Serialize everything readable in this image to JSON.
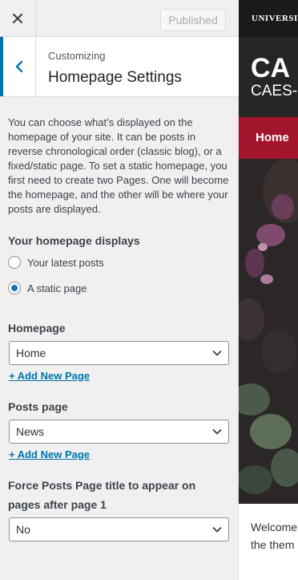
{
  "topbar": {
    "close_icon": "close-icon",
    "publish_label": "Published"
  },
  "section": {
    "back_icon": "chevron-left-icon",
    "breadcrumb": "Customizing",
    "title": "Homepage Settings"
  },
  "description": "You can choose what’s displayed on the homepage of your site. It can be posts in reverse chronological order (classic blog), or a fixed/static page. To set a static homepage, you first need to create two Pages. One will become the homepage, and the other will be where your posts are displayed.",
  "homepage_displays": {
    "label": "Your homepage displays",
    "options": [
      {
        "label": "Your latest posts",
        "checked": false
      },
      {
        "label": "A static page",
        "checked": true
      }
    ]
  },
  "homepage": {
    "label": "Homepage",
    "selected": "Home",
    "add_link": "+ Add New Page"
  },
  "posts_page": {
    "label": "Posts page",
    "selected": "News",
    "add_link": "+ Add New Page"
  },
  "force_title": {
    "label": "Force Posts Page title to appear on pages after page 1",
    "selected": "No"
  },
  "preview": {
    "university_bar": "UNIVERSIT",
    "logo": "CA",
    "subtitle": "CAES-",
    "nav_home": "Home",
    "welcome_line1": "Welcome",
    "welcome_line2": "the them"
  },
  "colors": {
    "accent": "#0073aa",
    "nav_red": "#a3142d",
    "header_dark": "#262626"
  }
}
